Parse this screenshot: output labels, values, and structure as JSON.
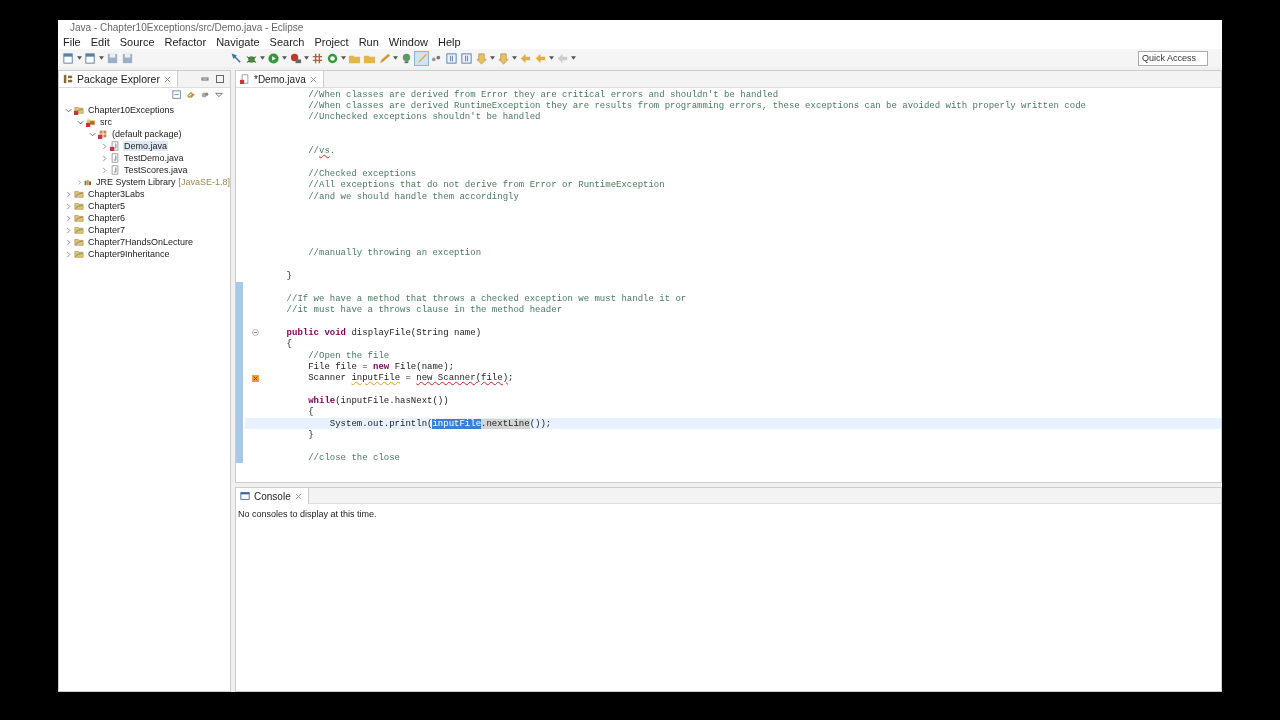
{
  "window": {
    "title": "Java - Chapter10Exceptions/src/Demo.java - Eclipse"
  },
  "menu": [
    "File",
    "Edit",
    "Source",
    "Refactor",
    "Navigate",
    "Search",
    "Project",
    "Run",
    "Window",
    "Help"
  ],
  "quick_access": {
    "placeholder": "Quick Access"
  },
  "package_explorer": {
    "title": "Package Explorer",
    "tree": [
      {
        "label": "Chapter10Exceptions",
        "kind": "project",
        "expanded": true,
        "selected": false,
        "error": true,
        "children": [
          {
            "label": "src",
            "kind": "source-folder",
            "expanded": true,
            "selected": false,
            "error": true,
            "children": [
              {
                "label": "(default package)",
                "kind": "package",
                "expanded": true,
                "selected": false,
                "error": true,
                "children": [
                  {
                    "label": "Demo.java",
                    "kind": "java-file",
                    "expanded": false,
                    "selected": true,
                    "error": true
                  },
                  {
                    "label": "TestDemo.java",
                    "kind": "java-file",
                    "expanded": false,
                    "selected": false,
                    "error": false
                  },
                  {
                    "label": "TestScores.java",
                    "kind": "java-file",
                    "expanded": false,
                    "selected": false,
                    "error": false
                  }
                ]
              }
            ]
          },
          {
            "label": "JRE System Library",
            "decoration": "[JavaSE-1.8]",
            "kind": "library",
            "expanded": false,
            "selected": false,
            "error": false
          }
        ]
      },
      {
        "label": "Chapter3Labs",
        "kind": "project",
        "expanded": false,
        "selected": false,
        "error": false
      },
      {
        "label": "Chapter5",
        "kind": "project",
        "expanded": false,
        "selected": false,
        "error": false
      },
      {
        "label": "Chapter6",
        "kind": "project",
        "expanded": false,
        "selected": false,
        "error": false
      },
      {
        "label": "Chapter7",
        "kind": "project",
        "expanded": false,
        "selected": false,
        "error": false
      },
      {
        "label": "Chapter7HandsOnLecture",
        "kind": "project",
        "expanded": false,
        "selected": false,
        "error": false
      },
      {
        "label": "Chapter9Inheritance",
        "kind": "project",
        "expanded": false,
        "selected": false,
        "error": false
      }
    ]
  },
  "editor": {
    "tab": "*Demo.java",
    "lines": [
      {
        "current": false,
        "changed": false,
        "segments": [
          {
            "kind": "comment",
            "text": "        //When classes are derived from Error they are critical errors and shouldn't be handled"
          }
        ]
      },
      {
        "current": false,
        "changed": false,
        "segments": [
          {
            "kind": "comment",
            "text": "        //When classes are derived RuntimeException they are results from programming errors, these exceptions can be avoided with properly written code"
          }
        ]
      },
      {
        "current": false,
        "changed": false,
        "segments": [
          {
            "kind": "comment",
            "text": "        //Unchecked exceptions shouldn't be handled"
          }
        ]
      },
      {
        "current": false,
        "changed": false
      },
      {
        "current": false,
        "changed": false
      },
      {
        "current": false,
        "changed": false,
        "segments": [
          {
            "kind": "comment",
            "text": "        //"
          },
          {
            "kind": "spelling",
            "text": "vs"
          },
          {
            "kind": "comment",
            "text": "."
          }
        ]
      },
      {
        "current": false,
        "changed": false
      },
      {
        "current": false,
        "changed": false,
        "segments": [
          {
            "kind": "comment",
            "text": "        //Checked exceptions"
          }
        ]
      },
      {
        "current": false,
        "changed": false,
        "segments": [
          {
            "kind": "comment",
            "text": "        //All exceptions that do not derive from Error or RuntimeException"
          }
        ]
      },
      {
        "current": false,
        "changed": false,
        "segments": [
          {
            "kind": "comment",
            "text": "        //and we should handle them accordingly"
          }
        ]
      },
      {
        "current": false,
        "changed": false
      },
      {
        "current": false,
        "changed": false
      },
      {
        "current": false,
        "changed": false
      },
      {
        "current": false,
        "changed": false
      },
      {
        "current": false,
        "changed": false,
        "segments": [
          {
            "kind": "comment",
            "text": "        //manually throwing an exception"
          }
        ]
      },
      {
        "current": false,
        "changed": false
      },
      {
        "current": false,
        "changed": false,
        "segments": [
          {
            "kind": "plain",
            "text": "    }"
          }
        ]
      },
      {
        "current": false,
        "changed": true
      },
      {
        "current": false,
        "changed": true,
        "segments": [
          {
            "kind": "comment",
            "text": "    //If we have a method that throws a checked exception we must handle it or"
          }
        ]
      },
      {
        "current": false,
        "changed": true,
        "segments": [
          {
            "kind": "comment",
            "text": "    //it must have a throws clause in the method header"
          }
        ]
      },
      {
        "current": false,
        "changed": true
      },
      {
        "current": false,
        "changed": true,
        "foldable": true,
        "segments": [
          {
            "kind": "keyword",
            "text": "    public "
          },
          {
            "kind": "keyword",
            "text": "void"
          },
          {
            "kind": "plain",
            "text": " displayFile(String name)"
          }
        ]
      },
      {
        "current": false,
        "changed": true,
        "segments": [
          {
            "kind": "plain",
            "text": "    {"
          }
        ]
      },
      {
        "current": false,
        "changed": true,
        "segments": [
          {
            "kind": "comment",
            "text": "        //Open the file"
          }
        ]
      },
      {
        "current": false,
        "changed": true,
        "segments": [
          {
            "kind": "plain",
            "text": "        File file = "
          },
          {
            "kind": "keyword",
            "text": "new"
          },
          {
            "kind": "plain",
            "text": " File(name);"
          }
        ]
      },
      {
        "current": false,
        "changed": true,
        "error": true,
        "segments": [
          {
            "kind": "plain",
            "text": "        Scanner "
          },
          {
            "kind": "warning",
            "text": "inputFile"
          },
          {
            "kind": "plain",
            "text": " = "
          },
          {
            "kind": "error",
            "text": "new Scanner(file)"
          },
          {
            "kind": "plain",
            "text": ";"
          }
        ]
      },
      {
        "current": false,
        "changed": true
      },
      {
        "current": false,
        "changed": true,
        "segments": [
          {
            "kind": "keyword",
            "text": "        while"
          },
          {
            "kind": "plain",
            "text": "(inputFile.hasNext())"
          }
        ]
      },
      {
        "current": false,
        "changed": true,
        "segments": [
          {
            "kind": "plain",
            "text": "        {"
          }
        ]
      },
      {
        "current": true,
        "changed": true,
        "segments": [
          {
            "kind": "plain",
            "text": "            System.out.println("
          },
          {
            "kind": "selected",
            "text": "inputFile"
          },
          {
            "kind": "occurrence",
            "text": ".nextLine"
          },
          {
            "kind": "plain",
            "text": "());"
          }
        ]
      },
      {
        "current": false,
        "changed": true,
        "segments": [
          {
            "kind": "plain",
            "text": "        }"
          }
        ]
      },
      {
        "current": false,
        "changed": true
      },
      {
        "current": false,
        "changed": true,
        "segments": [
          {
            "kind": "comment",
            "text": "        //close the close"
          }
        ]
      }
    ]
  },
  "console": {
    "title": "Console",
    "message": "No consoles to display at this time."
  }
}
